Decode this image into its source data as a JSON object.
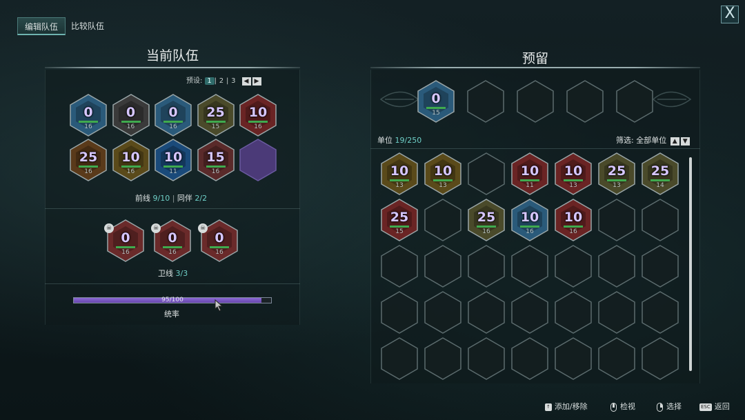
{
  "tabs": [
    {
      "label": "编辑队伍",
      "active": true
    },
    {
      "label": "比较队伍",
      "active": false
    }
  ],
  "close_label": "X",
  "current_team": {
    "title": "当前队伍",
    "preset": {
      "label": "预设:",
      "options": [
        "1",
        "2",
        "3"
      ],
      "selected": "1"
    },
    "frontline_units": [
      {
        "value": "0",
        "level": "16",
        "tint": "#2a5a7a"
      },
      {
        "value": "0",
        "level": "16",
        "tint": "#3a3a3a"
      },
      {
        "value": "0",
        "level": "16",
        "tint": "#2a5a7a"
      },
      {
        "value": "25",
        "level": "15",
        "tint": "#4a4a2a"
      },
      {
        "value": "10",
        "level": "16",
        "tint": "#6a2424"
      },
      {
        "value": "25",
        "level": "16",
        "tint": "#5a3a1a"
      },
      {
        "value": "10",
        "level": "16",
        "tint": "#5a4a1a"
      },
      {
        "value": "10",
        "level": "11",
        "tint": "#1a4a7a"
      },
      {
        "value": "15",
        "level": "16",
        "tint": "#5a2a2a"
      }
    ],
    "frontline_label": "前线",
    "frontline_count": "9/10",
    "companion_label": "同伴",
    "companion_count": "2/2",
    "guard_units": [
      {
        "value": "0",
        "level": "16",
        "tint": "#6a2a2a"
      },
      {
        "value": "0",
        "level": "16",
        "tint": "#6a2a2a"
      },
      {
        "value": "0",
        "level": "16",
        "tint": "#6a2a2a"
      }
    ],
    "guard_label": "卫线",
    "guard_count": "3/3",
    "command": {
      "text": "95/100",
      "value": 95,
      "max": 100,
      "label": "统率"
    }
  },
  "reserve": {
    "title": "预留",
    "highlighted_units": [
      {
        "value": "0",
        "level": "15",
        "tint": "#2a5a7a"
      }
    ],
    "units_label": "单位",
    "units_count": "19/250",
    "filter_label": "筛选:",
    "filter_value": "全部单位",
    "grid": [
      {
        "value": "10",
        "level": "13",
        "tint": "#5a4a1a"
      },
      {
        "value": "10",
        "level": "13",
        "tint": "#5a4a1a"
      },
      null,
      {
        "value": "10",
        "level": "11",
        "tint": "#6a2424"
      },
      {
        "value": "10",
        "level": "13",
        "tint": "#6a2424"
      },
      {
        "value": "25",
        "level": "13",
        "tint": "#4a4a2a"
      },
      {
        "value": "25",
        "level": "14",
        "tint": "#4a4a2a"
      },
      {
        "value": "25",
        "level": "15",
        "tint": "#6a2424"
      },
      null,
      {
        "value": "25",
        "level": "16",
        "tint": "#4a4a2a"
      },
      {
        "value": "10",
        "level": "16",
        "tint": "#2a5a7a"
      },
      {
        "value": "10",
        "level": "16",
        "tint": "#6a2424"
      },
      null,
      null
    ]
  },
  "hints": [
    {
      "key": "↑",
      "label": "添加/移除"
    },
    {
      "key": "mouse-middle",
      "label": "检视"
    },
    {
      "key": "mouse-right",
      "label": "选择"
    },
    {
      "key": "ESC",
      "label": "返回"
    }
  ],
  "colors": {
    "accent": "#6fd0c8",
    "value_text": "#d6c6ff",
    "health_bar": "#3faa4e",
    "command_fill": "#7a56c2",
    "empty_slot_highlight": "#4b3a78"
  }
}
